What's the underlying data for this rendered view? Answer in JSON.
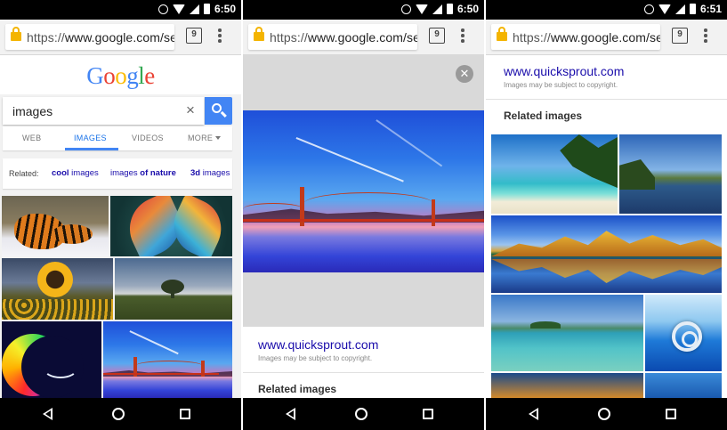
{
  "panels": [
    {
      "time": "6:50",
      "url": {
        "scheme": "https://",
        "host": "www.google.com/sea"
      },
      "tab_count": "9",
      "logo_letters": [
        "G",
        "o",
        "o",
        "g",
        "l",
        "e"
      ],
      "search": {
        "value": "images"
      },
      "tabs": [
        {
          "label": "WEB",
          "active": false
        },
        {
          "label": "IMAGES",
          "active": true
        },
        {
          "label": "VIDEOS",
          "active": false
        },
        {
          "label": "MORE",
          "active": false
        }
      ],
      "related": {
        "label": "Related:",
        "chips": [
          {
            "normal": "",
            "bold": "cool",
            "rest": " images"
          },
          {
            "normal": "images ",
            "bold": "of nature",
            "rest": ""
          },
          {
            "normal": "",
            "bold": "3d",
            "rest": " images"
          }
        ]
      }
    },
    {
      "time": "6:50",
      "url": {
        "scheme": "https://",
        "host": "www.google.com/sea"
      },
      "tab_count": "9",
      "close_glyph": "✕",
      "result": {
        "domain": "www.quicksprout.com",
        "copyright": "Images may be subject to copyright.",
        "related_title": "Related images"
      }
    },
    {
      "time": "6:51",
      "url": {
        "scheme": "https://",
        "host": "www.google.com/sea"
      },
      "tab_count": "9",
      "result": {
        "domain": "www.quicksprout.com",
        "copyright": "Images may be subject to copyright.",
        "related_title": "Related images"
      }
    }
  ],
  "icons": {
    "status": [
      "alarm-icon",
      "wifi-icon",
      "signal-icon",
      "battery-icon"
    ],
    "nav": [
      "back-icon",
      "home-icon",
      "recents-icon"
    ],
    "clear": "×"
  },
  "colors": {
    "google_blue": "#4285f4",
    "google_red": "#ea4335",
    "google_yellow": "#fbbc05",
    "google_green": "#34a853",
    "link": "#1a0dab",
    "lock": "#f4b400"
  }
}
